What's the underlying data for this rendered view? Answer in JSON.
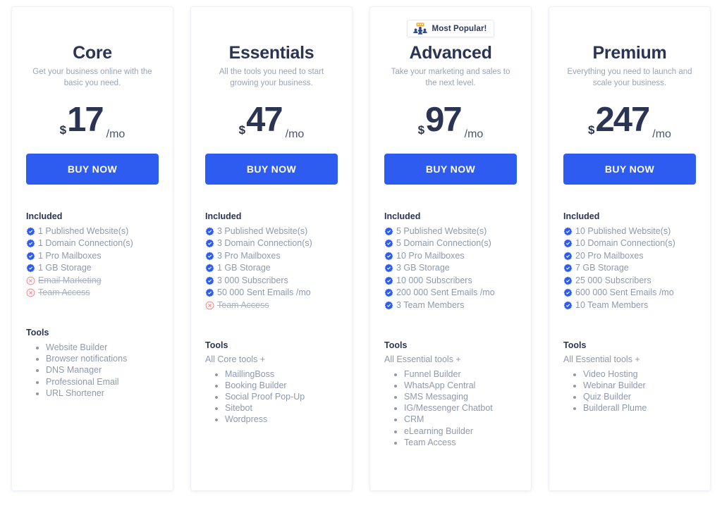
{
  "badge": {
    "label": "Most Popular!",
    "icon": "group-people-icon",
    "icon_color": "#2e4a8a",
    "icon_accent_color": "#f5a623"
  },
  "colors": {
    "accent": "#2f5cf0",
    "heading": "#2b3553",
    "body_text": "#8f99ad",
    "check_icon": "#2f5cf0",
    "cross_icon": "#f08a8a"
  },
  "labels": {
    "included_heading": "Included",
    "tools_heading": "Tools",
    "buy_button": "BUY NOW",
    "currency_symbol": "$",
    "period": "/mo"
  },
  "plans": [
    {
      "name": "Core",
      "description": "Get your business online with the basic you need.",
      "price": "17",
      "currency": "$",
      "period": "/mo",
      "cta": "BUY NOW",
      "most_popular": false,
      "included": [
        {
          "text": "1 Published Website(s)",
          "available": true
        },
        {
          "text": "1 Domain Connection(s)",
          "available": true
        },
        {
          "text": "1 Pro Mailboxes",
          "available": true
        },
        {
          "text": "1 GB Storage",
          "available": true
        },
        {
          "text": "Email Marketing",
          "available": false
        },
        {
          "text": "Team Access",
          "available": false
        }
      ],
      "tools_prefix": "",
      "tools": [
        "Website Builder",
        "Browser notifications",
        "DNS Manager",
        "Professional Email",
        "URL Shortener"
      ]
    },
    {
      "name": "Essentials",
      "description": "All the tools you need to start growing your business.",
      "price": "47",
      "currency": "$",
      "period": "/mo",
      "cta": "BUY NOW",
      "most_popular": false,
      "included": [
        {
          "text": "3 Published Website(s)",
          "available": true
        },
        {
          "text": "3 Domain Connection(s)",
          "available": true
        },
        {
          "text": "3 Pro Mailboxes",
          "available": true
        },
        {
          "text": "1 GB Storage",
          "available": true
        },
        {
          "text": "3 000 Subscribers",
          "available": true
        },
        {
          "text": "50 000 Sent Emails /mo",
          "available": true
        },
        {
          "text": "Team Access",
          "available": false
        }
      ],
      "tools_prefix": "All Core tools +",
      "tools": [
        "MaillingBoss",
        "Booking Builder",
        "Social Proof Pop-Up",
        "Sitebot",
        "Wordpress"
      ]
    },
    {
      "name": "Advanced",
      "description": "Take your marketing and sales to the next level.",
      "price": "97",
      "currency": "$",
      "period": "/mo",
      "cta": "BUY NOW",
      "most_popular": true,
      "included": [
        {
          "text": "5 Published Website(s)",
          "available": true
        },
        {
          "text": "5 Domain Connection(s)",
          "available": true
        },
        {
          "text": "10 Pro Mailboxes",
          "available": true
        },
        {
          "text": "3 GB Storage",
          "available": true
        },
        {
          "text": "10 000 Subscribers",
          "available": true
        },
        {
          "text": "200 000 Sent Emails /mo",
          "available": true
        },
        {
          "text": "3 Team Members",
          "available": true
        }
      ],
      "tools_prefix": "All Essential tools +",
      "tools": [
        "Funnel Builder",
        "WhatsApp Central",
        "SMS Messaging",
        "IG/Messenger Chatbot",
        "CRM",
        "eLearning Builder",
        "Team Access"
      ]
    },
    {
      "name": "Premium",
      "description": "Everything you need to launch and scale your business.",
      "price": "247",
      "currency": "$",
      "period": "/mo",
      "cta": "BUY NOW",
      "most_popular": false,
      "included": [
        {
          "text": "10 Published Website(s)",
          "available": true
        },
        {
          "text": "10 Domain Connection(s)",
          "available": true
        },
        {
          "text": "20 Pro Mailboxes",
          "available": true
        },
        {
          "text": "7 GB Storage",
          "available": true
        },
        {
          "text": "25 000 Subscribers",
          "available": true
        },
        {
          "text": "600 000 Sent Emails /mo",
          "available": true
        },
        {
          "text": "10 Team Members",
          "available": true
        }
      ],
      "tools_prefix": "All Essential tools +",
      "tools": [
        "Video Hosting",
        "Webinar Builder",
        "Quiz Builder",
        "Builderall Plume"
      ]
    }
  ]
}
